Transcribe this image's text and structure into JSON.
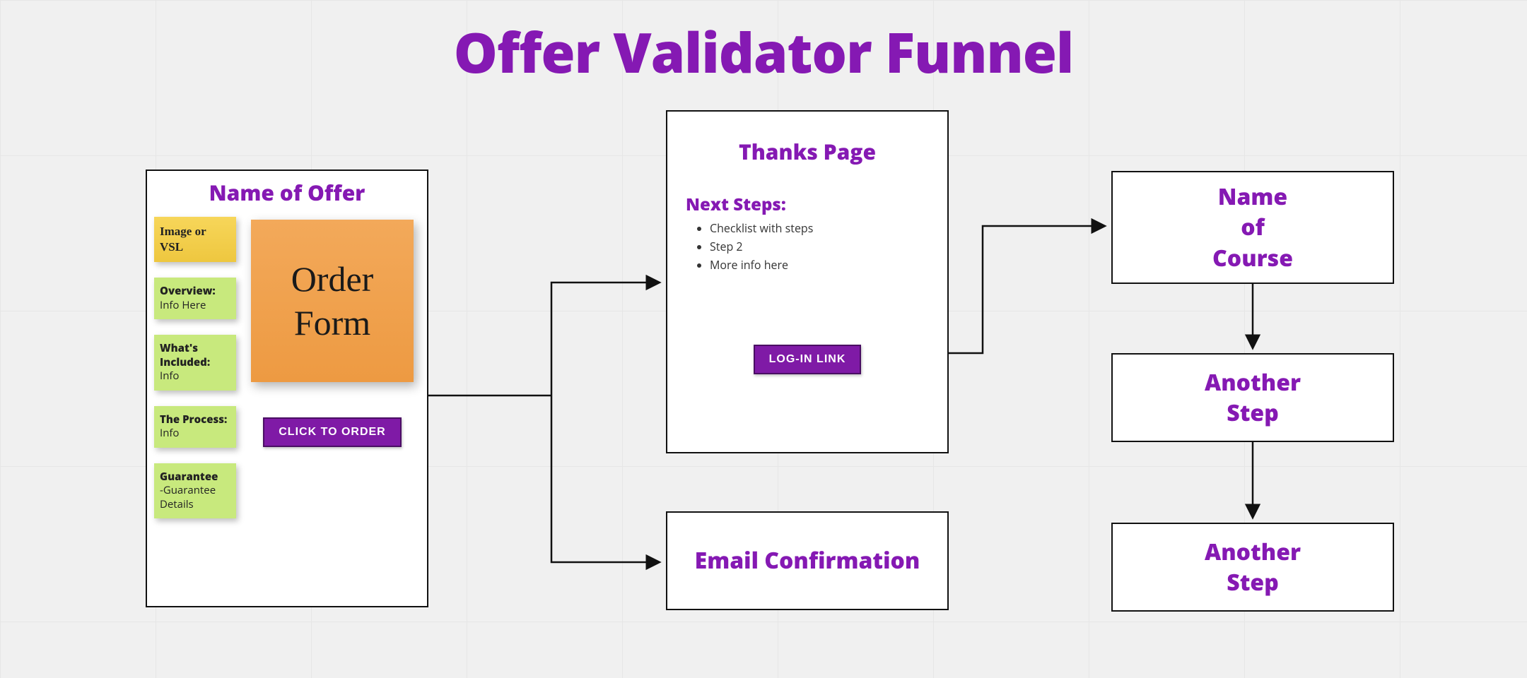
{
  "title": "Offer Validator Funnel",
  "colors": {
    "accent": "#8519b3"
  },
  "offer": {
    "heading": "Name of Offer",
    "image_note": "Image or VSL",
    "order_sticky": "Order Form",
    "cta": "CLICK TO ORDER",
    "blocks": {
      "overview": {
        "label": "Overview:",
        "text": "Info Here"
      },
      "included": {
        "label": "What's Included:",
        "text": "Info"
      },
      "process": {
        "label": "The Process:",
        "text": "Info"
      },
      "guarantee": {
        "label": "Guarantee",
        "text": "-Guarantee Details"
      }
    }
  },
  "thanks": {
    "heading": "Thanks Page",
    "next_label": "Next Steps:",
    "steps": [
      "Checklist with steps",
      "Step 2",
      "More info here"
    ],
    "login_btn": "LOG-IN LINK"
  },
  "email_box": "Email Confirmation",
  "course_box_l1": "Name",
  "course_box_l2": "of",
  "course_box_l3": "Course",
  "step2_l1": "Another",
  "step2_l2": "Step",
  "step3_l1": "Another",
  "step3_l2": "Step"
}
